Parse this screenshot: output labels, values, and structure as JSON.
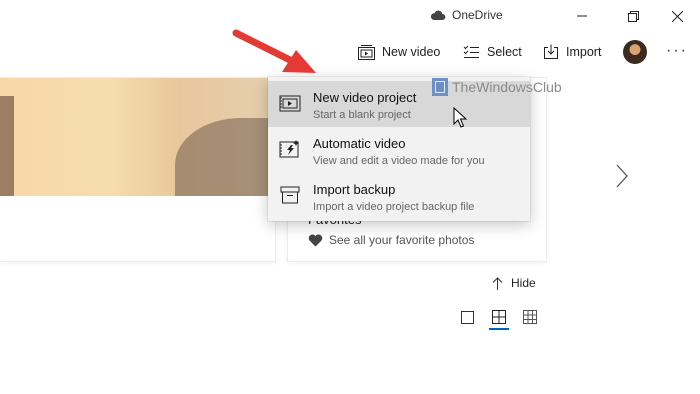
{
  "titlebar": {
    "app_name": "OneDrive",
    "icons": [
      "cloud-icon",
      "minimize-icon",
      "restore-icon",
      "close-icon"
    ]
  },
  "toolbar": {
    "new_video_label": "New video",
    "select_label": "Select",
    "import_label": "Import",
    "more_label": "···",
    "icons": [
      "new-video-icon",
      "select-checklist-icon",
      "import-icon"
    ]
  },
  "cards": {
    "favorites_title": "Favorites",
    "favorites_subtitle": "See all your favorite photos"
  },
  "hide_label": "Hide",
  "menu": {
    "items": [
      {
        "title": "New video project",
        "subtitle": "Start a blank project",
        "icon": "video-project-icon"
      },
      {
        "title": "Automatic video",
        "subtitle": "View and edit a video made for you",
        "icon": "automatic-video-icon"
      },
      {
        "title": "Import backup",
        "subtitle": "Import a video project backup file",
        "icon": "import-backup-icon"
      }
    ]
  },
  "watermark": "TheWindowsClub",
  "colors": {
    "accent": "#0067c0",
    "annotation_arrow": "#e53935",
    "menu_bg": "#f2f2f2",
    "menu_hover": "#d8d8d8"
  }
}
